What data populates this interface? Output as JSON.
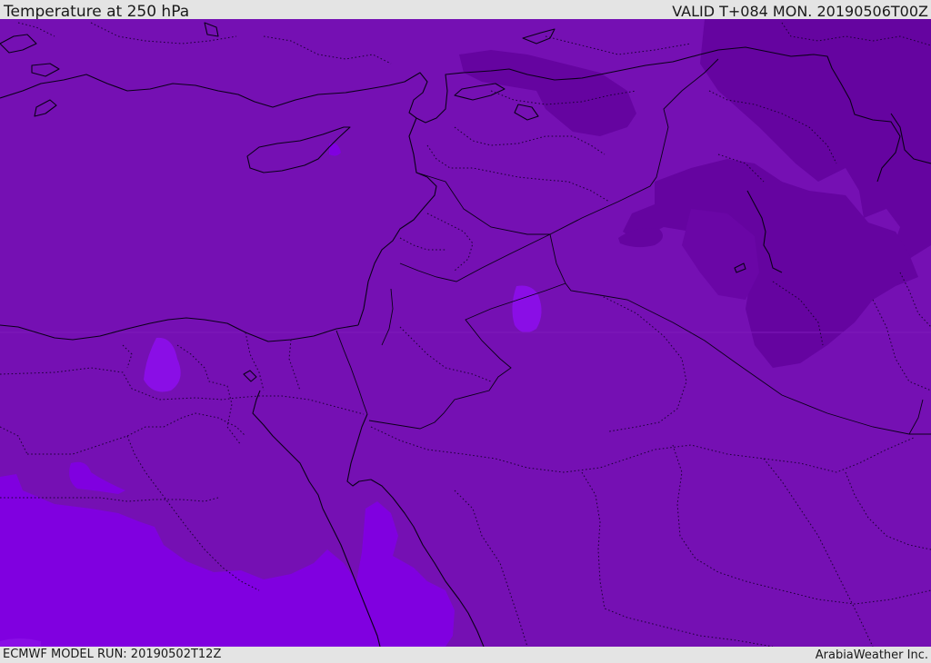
{
  "header": {
    "title": "Temperature at 250 hPa",
    "valid": "VALID T+084 MON. 20190506T00Z"
  },
  "footer": {
    "model_run": "ECMWF MODEL RUN: 20190502T12Z",
    "credit": "ArabiaWeather Inc."
  },
  "colors": {
    "base_field": "#7510b3",
    "cold_field": "#6504a0",
    "warm_field": "#8000e0",
    "warm_spot": "#8a0ee6",
    "coastline": "#0a0018",
    "dotted_border": "#1c0036"
  }
}
